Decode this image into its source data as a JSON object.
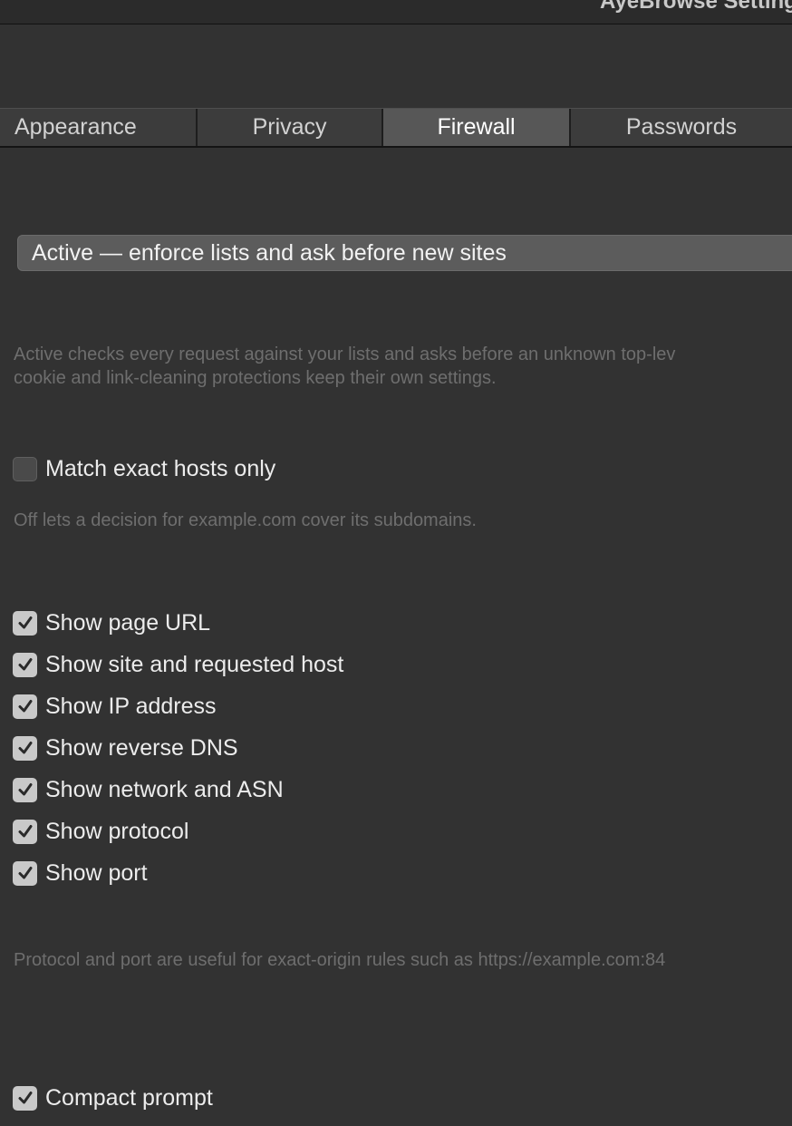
{
  "window": {
    "title": "AyeBrowse Settings"
  },
  "tabs": [
    {
      "label": "Appearance",
      "active": false
    },
    {
      "label": "Privacy",
      "active": false
    },
    {
      "label": "Firewall",
      "active": true
    },
    {
      "label": "Passwords",
      "active": false
    }
  ],
  "firewall": {
    "mode_value": "Active — enforce lists and ask before new sites",
    "mode_help_line1": "Active checks every request against your lists and asks before an unknown top-lev",
    "mode_help_line2": "cookie and link-cleaning protections keep their own settings.",
    "exact_hosts": {
      "label": "Match exact hosts only",
      "checked": false
    },
    "exact_hosts_help": "Off lets a decision for example.com cover its subdomains.",
    "show_options": [
      {
        "label": "Show page URL",
        "checked": true
      },
      {
        "label": "Show site and requested host",
        "checked": true
      },
      {
        "label": "Show IP address",
        "checked": true
      },
      {
        "label": "Show reverse DNS",
        "checked": true
      },
      {
        "label": "Show network and ASN",
        "checked": true
      },
      {
        "label": "Show protocol",
        "checked": true
      },
      {
        "label": "Show port",
        "checked": true
      }
    ],
    "show_help": "Protocol and port are useful for exact-origin rules such as https://example.com:84",
    "compact_prompt": {
      "label": "Compact prompt",
      "checked": true
    }
  },
  "colors": {
    "background": "#323232",
    "tab_active": "#575757",
    "checkbox_on": "#c9c9c9",
    "help_text": "#6e6e6e"
  }
}
